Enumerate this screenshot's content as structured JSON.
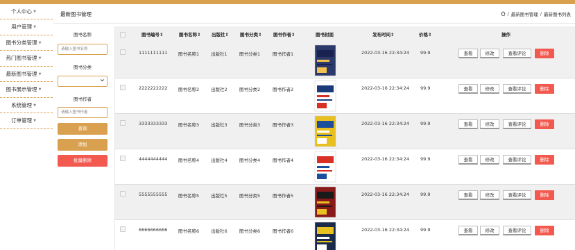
{
  "sidebar": {
    "items": [
      {
        "label": "个人中心"
      },
      {
        "label": "用户管理"
      },
      {
        "label": "图书分类管理"
      },
      {
        "label": "热门图书管理"
      },
      {
        "label": "最新图书管理"
      },
      {
        "label": "图书展示管理"
      },
      {
        "label": "系统管理"
      },
      {
        "label": "订单管理"
      }
    ]
  },
  "header": {
    "title": "最新图书管理",
    "breadcrumb": [
      "最新图书管理",
      "最新图书列表"
    ]
  },
  "search": {
    "name_label": "图书名称",
    "name_placeholder": "请输入图书名称",
    "category_label": "图书分类",
    "author_label": "图书作者",
    "author_placeholder": "请输入图书作者",
    "search_button": "查询",
    "add_button": "添加",
    "batch_delete_button": "批量删除"
  },
  "table": {
    "headers": [
      "图书编号",
      "图书名称",
      "出版社",
      "图书分类",
      "图书作者",
      "图书封面",
      "发布时间",
      "价格",
      "操作"
    ],
    "sort_symbol": "⇕",
    "rows": [
      {
        "id": "1111111111",
        "name": "图书名称1",
        "publisher": "出版社1",
        "category": "图书分类1",
        "author": "图书作者1",
        "time": "2022-03-16 22:34:24",
        "price": "99.9"
      },
      {
        "id": "2222222222",
        "name": "图书名称2",
        "publisher": "出版社2",
        "category": "图书分类2",
        "author": "图书作者2",
        "time": "2022-03-16 22:34:24",
        "price": "99.9"
      },
      {
        "id": "3333333333",
        "name": "图书名称3",
        "publisher": "出版社3",
        "category": "图书分类3",
        "author": "图书作者3",
        "time": "2022-03-16 22:34:24",
        "price": "99.9"
      },
      {
        "id": "4444444444",
        "name": "图书名称4",
        "publisher": "出版社4",
        "category": "图书分类4",
        "author": "图书作者4",
        "time": "2022-03-16 22:34:24",
        "price": "99.9"
      },
      {
        "id": "5555555555",
        "name": "图书名称5",
        "publisher": "出版社5",
        "category": "图书分类5",
        "author": "图书作者5",
        "time": "2022-03-16 22:34:24",
        "price": "99.9"
      },
      {
        "id": "6666666666",
        "name": "图书名称6",
        "publisher": "出版社6",
        "category": "图书分类6",
        "author": "图书作者6",
        "time": "2022-03-16 22:34:24",
        "price": "99.9"
      }
    ],
    "actions": {
      "view": "查看",
      "edit": "修改",
      "view_comments": "查看评论",
      "delete": "删除"
    }
  },
  "colors": {
    "accent": "#d9a050",
    "danger": "#f25a50",
    "alt_row": "#f0f0f0"
  }
}
